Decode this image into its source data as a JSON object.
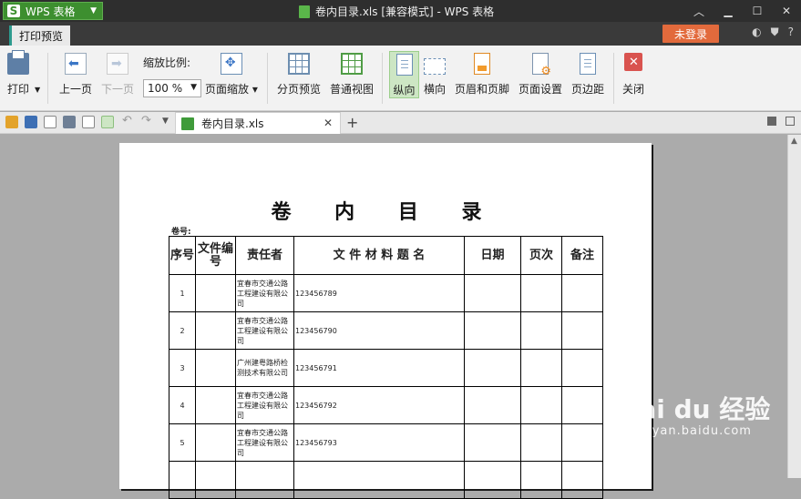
{
  "titlebar": {
    "app_label": "WPS 表格",
    "app_logo": "S",
    "window_title": "卷内目录.xls [兼容模式] - WPS 表格"
  },
  "tabbar": {
    "active_tab": "打印预览",
    "login_label": "未登录",
    "help_label": "?"
  },
  "ribbon": {
    "print": "打印",
    "prev_page": "上一页",
    "next_page": "下一页",
    "zoom_label": "缩放比例:",
    "zoom_value": "100 %",
    "page_zoom": "页面缩放",
    "page_break_preview": "分页预览",
    "normal_view": "普通视图",
    "portrait": "纵向",
    "landscape": "横向",
    "header_footer": "页眉和页脚",
    "page_setup": "页面设置",
    "margins": "页边距",
    "close": "关闭"
  },
  "quickbar": {
    "doc_tab": "卷内目录.xls"
  },
  "document": {
    "title": "卷 内 目 录",
    "volume_label": "卷号:",
    "headers": [
      "序号",
      "文件编号",
      "责任者",
      "文 件 材 料 题 名",
      "日期",
      "页次",
      "备注"
    ],
    "rows": [
      {
        "no": "1",
        "file_no": "",
        "org": "宜春市交通公路工程建设有限公司",
        "title": "123456789",
        "date": "",
        "page": "",
        "note": ""
      },
      {
        "no": "2",
        "file_no": "",
        "org": "宜春市交通公路工程建设有限公司",
        "title": "123456790",
        "date": "",
        "page": "",
        "note": ""
      },
      {
        "no": "3",
        "file_no": "",
        "org": "广州建粤路桥检测技术有限公司",
        "title": "123456791",
        "date": "",
        "page": "",
        "note": ""
      },
      {
        "no": "4",
        "file_no": "",
        "org": "宜春市交通公路工程建设有限公司",
        "title": "123456792",
        "date": "",
        "page": "",
        "note": ""
      },
      {
        "no": "5",
        "file_no": "",
        "org": "宜春市交通公路工程建设有限公司",
        "title": "123456793",
        "date": "",
        "page": "",
        "note": ""
      },
      {
        "no": "",
        "file_no": "",
        "org": "",
        "title": "",
        "date": "",
        "page": "",
        "note": ""
      }
    ]
  },
  "watermark": {
    "main": "Bai du 经验",
    "sub": "jingyan.baidu.com"
  },
  "colors": {
    "titlebar_bg": "#2e2e2e",
    "app_button": "#3d8f2f",
    "login_button": "#e26a3c",
    "ribbon_bg": "#f2f2f2",
    "active_button": "#cde6c4",
    "workspace_bg": "#ababab"
  }
}
